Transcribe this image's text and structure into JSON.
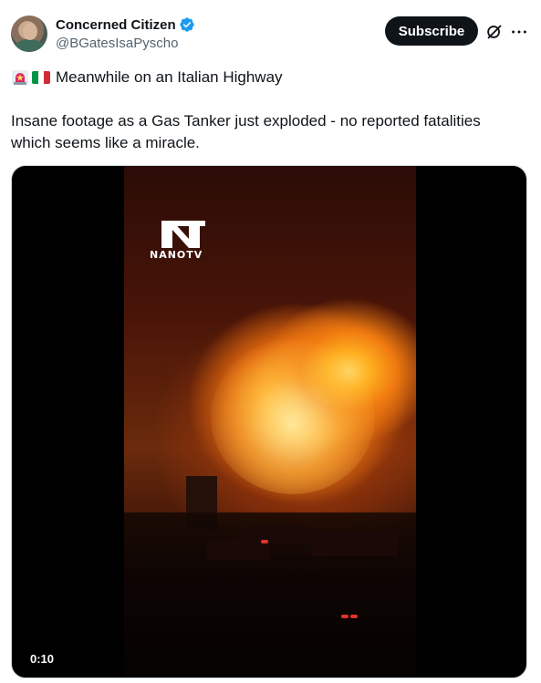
{
  "author": {
    "name": "Concerned Citizen",
    "handle": "@BGatesIsaPyscho"
  },
  "actions": {
    "subscribe_label": "Subscribe"
  },
  "post": {
    "headline": "Meanwhile on an Italian Highway",
    "body": "Insane footage as a Gas Tanker just exploded - no reported fatalities\nwhich seems like a miracle."
  },
  "media": {
    "watermark_text": "NANOTV",
    "duration": "0:10"
  },
  "icons": {
    "verified": "verified-badge-icon",
    "grok": "grok-icon",
    "more": "more-icon",
    "siren": "siren-emoji",
    "flag": "italy-flag-emoji"
  },
  "colors": {
    "text_primary": "#0f1419",
    "text_secondary": "#536471",
    "verified_blue": "#1d9bf0",
    "subscribe_bg": "#0f1419"
  }
}
